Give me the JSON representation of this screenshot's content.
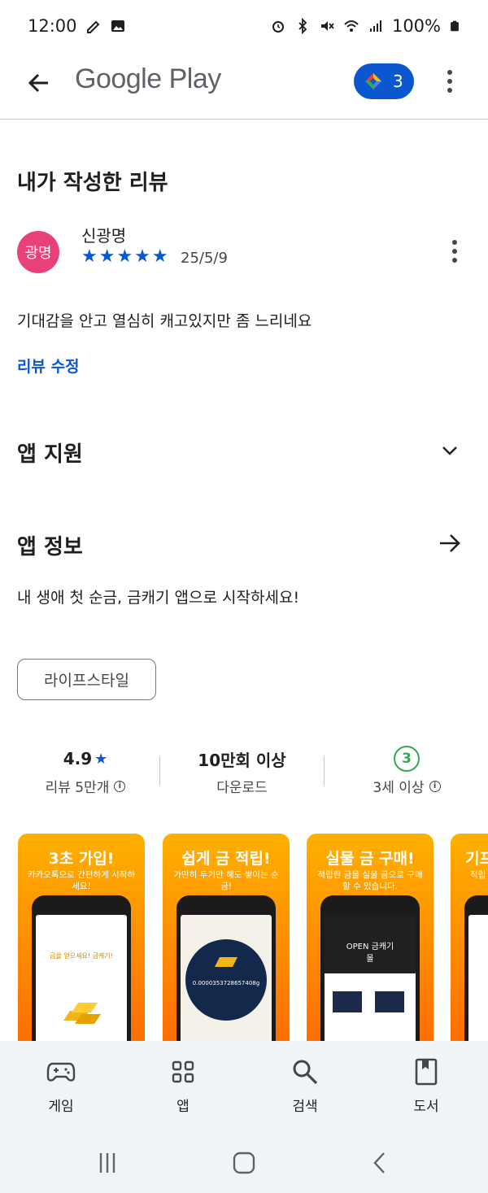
{
  "status_bar": {
    "time": "12:00",
    "battery": "100%"
  },
  "app_bar": {
    "title": "Google Play",
    "points": "3"
  },
  "my_review": {
    "title": "내가 작성한 리뷰",
    "avatar_text": "광명",
    "reviewer": "신광명",
    "rating": 5,
    "stars": "★★★★★",
    "date": "25/5/9",
    "text": "기대감을 안고 열심히 캐고있지만 좀 느리네요",
    "edit_label": "리뷰 수정"
  },
  "app_support": {
    "title": "앱 지원"
  },
  "app_info": {
    "title": "앱 정보",
    "description": "내 생애 첫 순금, 금캐기 앱으로 시작하세요!",
    "category_chip": "라이프스타일"
  },
  "stats": {
    "rating_value": "4.9",
    "rating_label": "리뷰 5만개",
    "downloads_value": "10만회 이상",
    "downloads_label": "다운로드",
    "age_value": "3",
    "age_label": "3세 이상"
  },
  "screenshots": [
    {
      "title": "3초 가입!",
      "subtitle": "카카오톡으로 간편하게 시작하세요!",
      "screen_text": "금을 얻으세요! 금캐기!"
    },
    {
      "title": "쉽게 금 적립!",
      "subtitle": "가만히 두기만 해도 쌓이는 순금!",
      "screen_text": "0.0000353728657408g"
    },
    {
      "title": "실물 금 구매!",
      "subtitle": "적립한 금을 실물 금으로 구매 할 수 있습니다.",
      "screen_text": "OPEN 금캐기 몰"
    },
    {
      "title": "기프",
      "subtitle": "적립 기프",
      "screen_text": ""
    }
  ],
  "bottom_nav": {
    "games": "게임",
    "apps": "앱",
    "search": "검색",
    "books": "도서"
  },
  "colors": {
    "accent": "#0b57d0",
    "avatar": "#e8417a",
    "age_badge": "#34a853",
    "screenshot_orange": "#ff8a00"
  }
}
